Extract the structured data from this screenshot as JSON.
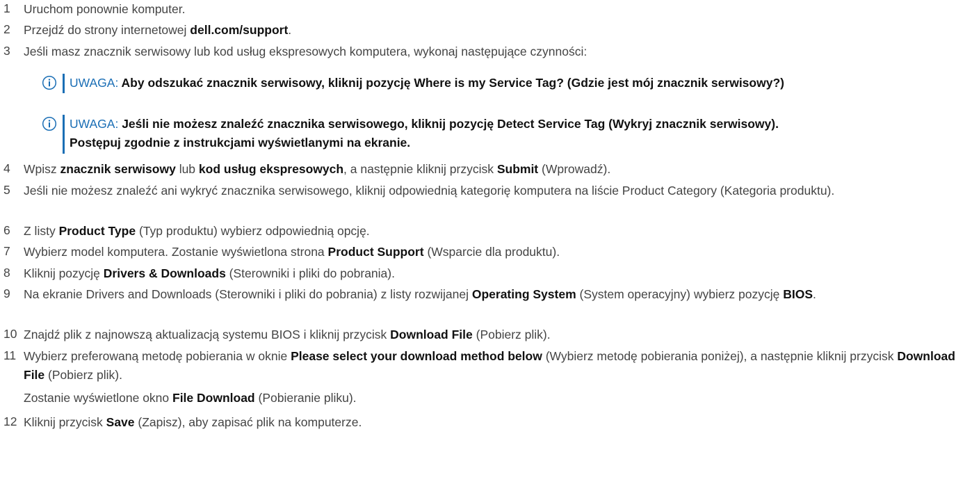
{
  "steps": [
    {
      "num": "1",
      "parts": [
        {
          "t": "Uruchom ponownie komputer."
        }
      ]
    },
    {
      "num": "2",
      "parts": [
        {
          "t": "Przejdź do strony internetowej "
        },
        {
          "t": "dell.com/support",
          "b": true
        },
        {
          "t": "."
        }
      ]
    },
    {
      "num": "3",
      "parts": [
        {
          "t": "Jeśli masz znacznik serwisowy lub kod usług ekspresowych komputera, wykonaj następujące czynności:"
        }
      ]
    },
    {
      "num": "4",
      "parts": [
        {
          "t": "Wpisz "
        },
        {
          "t": "znacznik serwisowy",
          "b": true
        },
        {
          "t": " lub "
        },
        {
          "t": "kod usług ekspresowych",
          "b": true
        },
        {
          "t": ", a następnie kliknij przycisk "
        },
        {
          "t": "Submit",
          "b": true
        },
        {
          "t": " (Wprowadź)."
        }
      ]
    },
    {
      "num": "5",
      "parts": [
        {
          "t": "Jeśli nie możesz znaleźć ani wykryć znacznika serwisowego, kliknij odpowiednią kategorię komputera na liście Product Category (Kategoria produktu)."
        }
      ]
    },
    {
      "num": "6",
      "parts": [
        {
          "t": "Z listy "
        },
        {
          "t": "Product Type",
          "b": true
        },
        {
          "t": " (Typ produktu) wybierz odpowiednią opcję."
        }
      ]
    },
    {
      "num": "7",
      "parts": [
        {
          "t": "Wybierz model komputera. Zostanie wyświetlona strona "
        },
        {
          "t": "Product Support",
          "b": true
        },
        {
          "t": " (Wsparcie dla produktu)."
        }
      ]
    },
    {
      "num": "8",
      "parts": [
        {
          "t": "Kliknij pozycję "
        },
        {
          "t": "Drivers & Downloads",
          "b": true
        },
        {
          "t": " (Sterowniki i pliki do pobrania)."
        }
      ]
    },
    {
      "num": "9",
      "parts": [
        {
          "t": "Na ekranie Drivers and Downloads (Sterowniki i pliki do pobrania) z listy rozwijanej "
        },
        {
          "t": "Operating System",
          "b": true
        },
        {
          "t": " (System operacyjny) wybierz pozycję "
        },
        {
          "t": "BIOS",
          "b": true
        },
        {
          "t": "."
        }
      ]
    },
    {
      "num": "10",
      "parts": [
        {
          "t": "Znajdź plik z najnowszą aktualizacją systemu BIOS i kliknij przycisk "
        },
        {
          "t": "Download File",
          "b": true
        },
        {
          "t": " (Pobierz plik)."
        }
      ]
    },
    {
      "num": "11",
      "parts": [
        {
          "t": "Wybierz preferowaną metodę pobierania w oknie "
        },
        {
          "t": "Please select your download method below",
          "b": true
        },
        {
          "t": " (Wybierz metodę pobierania poniżej), a następnie kliknij przycisk "
        },
        {
          "t": "Download File",
          "b": true
        },
        {
          "t": " (Pobierz plik)."
        }
      ]
    },
    {
      "num": "12",
      "parts": [
        {
          "t": "Kliknij przycisk "
        },
        {
          "t": "Save",
          "b": true
        },
        {
          "t": " (Zapisz), aby zapisać plik na komputerze."
        }
      ]
    }
  ],
  "notes": [
    {
      "label": "UWAGA:",
      "text": "Aby odszukać znacznik serwisowy, kliknij pozycję Where is my Service Tag? (Gdzie jest mój znacznik serwisowy?)"
    },
    {
      "label": "UWAGA:",
      "text": "Jeśli nie możesz znaleźć znacznika serwisowego, kliknij pozycję Detect Service Tag (Wykryj znacznik serwisowy).",
      "text2": "Postępuj zgodnie z instrukcjami wyświetlanymi na ekranie."
    }
  ],
  "step11_sub": {
    "parts": [
      {
        "t": "Zostanie wyświetlone okno "
      },
      {
        "t": "File Download",
        "b": true
      },
      {
        "t": " (Pobieranie pliku)."
      }
    ]
  },
  "colors": {
    "accent": "#1a6eb5",
    "body_text": "#444444",
    "bold_text": "#111111"
  },
  "icons": {
    "note": "info-circle-icon"
  }
}
